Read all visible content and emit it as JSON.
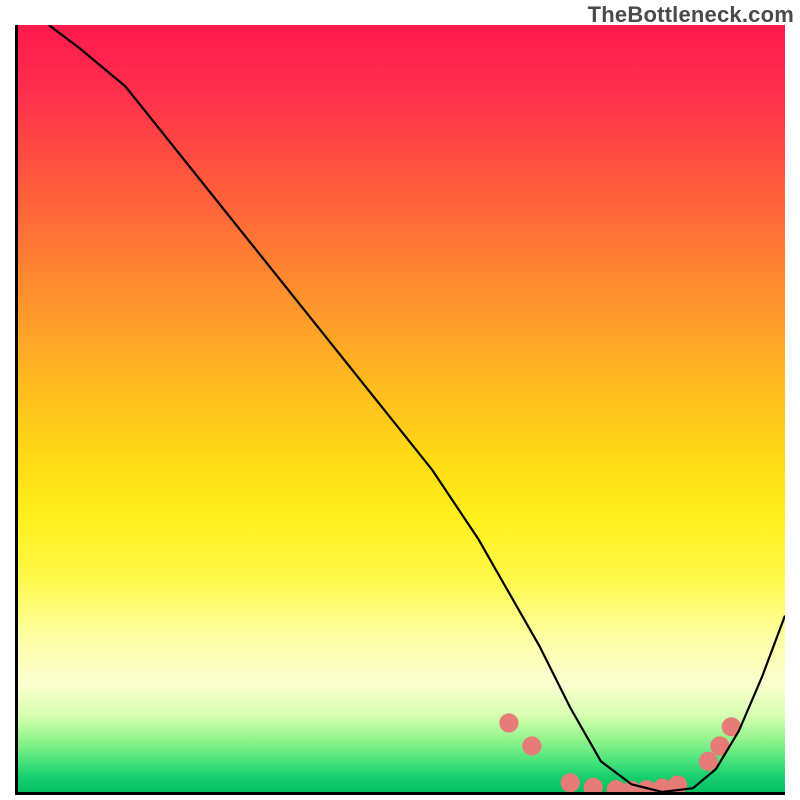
{
  "watermark": "TheBottleneck.com",
  "chart_data": {
    "type": "line",
    "title": "",
    "xlabel": "",
    "ylabel": "",
    "xlim": [
      0,
      100
    ],
    "ylim": [
      0,
      100
    ],
    "gradient_stops": [
      {
        "pct": 0,
        "color": "#ff1a4d"
      },
      {
        "pct": 22,
        "color": "#ff5e3b"
      },
      {
        "pct": 46,
        "color": "#ffb720"
      },
      {
        "pct": 64,
        "color": "#ffef1a"
      },
      {
        "pct": 80,
        "color": "#feffa5"
      },
      {
        "pct": 90,
        "color": "#d7ffb2"
      },
      {
        "pct": 100,
        "color": "#05bf64"
      }
    ],
    "series": [
      {
        "name": "bottleneck-curve",
        "x": [
          4,
          8,
          14,
          22,
          30,
          38,
          46,
          54,
          60,
          64,
          68,
          72,
          76,
          80,
          84,
          88,
          91,
          94,
          97,
          100
        ],
        "y": [
          100,
          97,
          92,
          82,
          72,
          62,
          52,
          42,
          33,
          26,
          19,
          11,
          4,
          1,
          0,
          0.5,
          3,
          8,
          15,
          23
        ]
      }
    ],
    "markers": {
      "name": "highlight-dots",
      "color": "#e77b78",
      "radius": 9,
      "points": [
        {
          "x": 64,
          "y": 9
        },
        {
          "x": 67,
          "y": 6
        },
        {
          "x": 72,
          "y": 1.2
        },
        {
          "x": 75,
          "y": 0.6
        },
        {
          "x": 78,
          "y": 0.3
        },
        {
          "x": 80,
          "y": 0.2
        },
        {
          "x": 82,
          "y": 0.3
        },
        {
          "x": 84,
          "y": 0.5
        },
        {
          "x": 86,
          "y": 0.9
        },
        {
          "x": 90,
          "y": 4
        },
        {
          "x": 91.5,
          "y": 6
        },
        {
          "x": 93,
          "y": 8.5
        }
      ]
    }
  }
}
